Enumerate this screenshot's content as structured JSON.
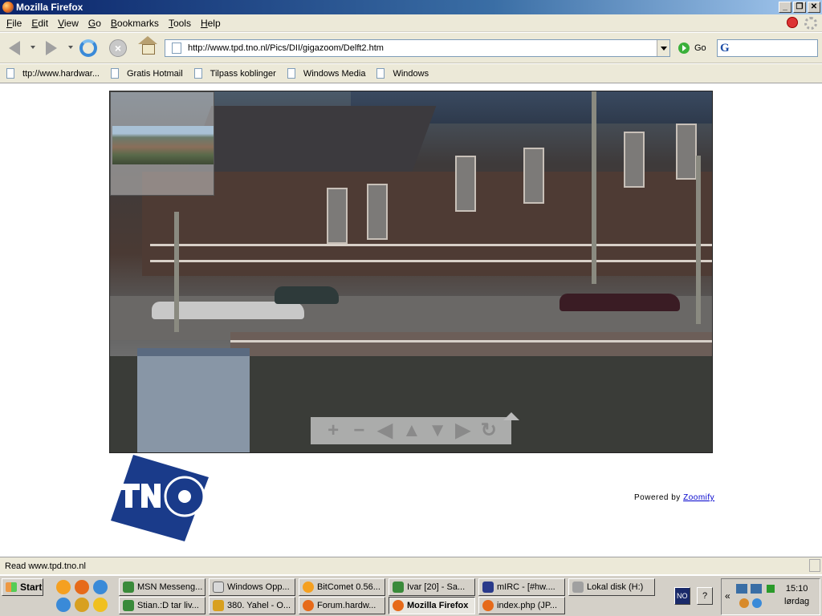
{
  "window": {
    "title": "Mozilla Firefox"
  },
  "menu": [
    "File",
    "Edit",
    "View",
    "Go",
    "Bookmarks",
    "Tools",
    "Help"
  ],
  "nav": {
    "url": "http://www.tpd.tno.nl/Pics/DII/gigazoom/Delft2.htm",
    "go_label": "Go",
    "search_engine": "G"
  },
  "bookmarks": [
    "ttp://www.hardwar...",
    "Gratis Hotmail",
    "Tilpass koblinger",
    "Windows Media",
    "Windows"
  ],
  "content": {
    "logo": "TNO",
    "powered_prefix": "Powered by ",
    "powered_link": "Zoomify"
  },
  "status": {
    "text": "Read www.tpd.tno.nl"
  },
  "taskbar": {
    "start": "Start",
    "row1": [
      "MSN Messeng...",
      "Windows Opp...",
      "BitComet 0.56...",
      "Ivar [20] - Sa...",
      "mIRC - [#hw....",
      "Lokal disk (H:)"
    ],
    "row2": [
      "Stian.:D tar liv...",
      "380. Yahel - O...",
      "Forum.hardw...",
      "Mozilla Firefox",
      "index.php (JP..."
    ],
    "lang": "NO",
    "clock_time": "15:10",
    "clock_day": "lørdag"
  }
}
